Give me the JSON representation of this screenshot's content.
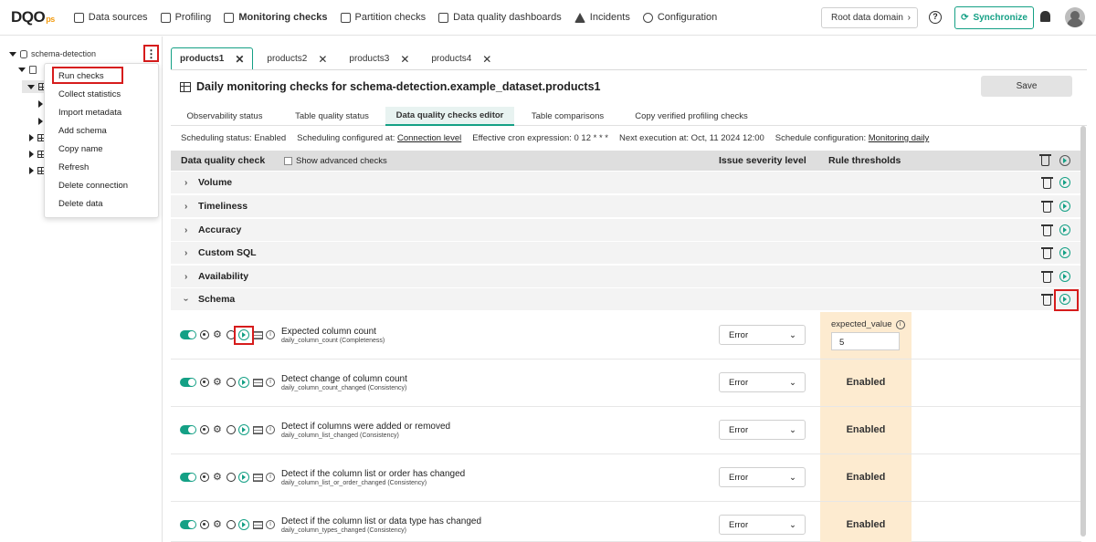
{
  "logo": {
    "main": "DQO",
    "suffix": "ps"
  },
  "nav": [
    {
      "label": "Data sources",
      "icon": "data-sources-icon"
    },
    {
      "label": "Profiling",
      "icon": "profiling-icon"
    },
    {
      "label": "Monitoring checks",
      "icon": "monitoring-icon",
      "active": true
    },
    {
      "label": "Partition checks",
      "icon": "partition-icon"
    },
    {
      "label": "Data quality dashboards",
      "icon": "dashboard-icon"
    },
    {
      "label": "Incidents",
      "icon": "warning-icon"
    },
    {
      "label": "Configuration",
      "icon": "gear-icon"
    }
  ],
  "header": {
    "root_domain": "Root data domain",
    "help": "?",
    "sync": "Synchronize"
  },
  "sidebar": {
    "connection": "schema-detection",
    "menu_dots": "⋮",
    "context_menu": [
      "Run checks",
      "Collect statistics",
      "Import metadata",
      "Add schema",
      "Copy name",
      "Refresh",
      "Delete connection",
      "Delete data"
    ]
  },
  "tabs": [
    {
      "label": "products1",
      "active": true
    },
    {
      "label": "products2"
    },
    {
      "label": "products3"
    },
    {
      "label": "products4"
    }
  ],
  "tab_close": "✕",
  "page_title": "Daily monitoring checks for schema-detection.example_dataset.products1",
  "save_label": "Save",
  "subtabs": [
    "Observability status",
    "Table quality status",
    "Data quality checks editor",
    "Table comparisons",
    "Copy verified profiling checks"
  ],
  "schedule": {
    "status": "Scheduling status: Enabled",
    "configured_prefix": "Scheduling configured at:",
    "configured_link": "Connection level",
    "cron": "Effective cron expression: 0 12 * * *",
    "next": "Next execution at: Oct, 11 2024 12:00",
    "config_prefix": "Schedule configuration:",
    "config_link": "Monitoring daily"
  },
  "table": {
    "col_check": "Data quality check",
    "advanced": "Show advanced checks",
    "col_severity": "Issue severity level",
    "col_thresholds": "Rule thresholds"
  },
  "groups": [
    "Volume",
    "Timeliness",
    "Accuracy",
    "Custom SQL",
    "Availability",
    "Schema"
  ],
  "checks": [
    {
      "name": "Expected column count",
      "sub": "daily_column_count (Completeness)",
      "severity": "Error",
      "threshold_label": "expected_value",
      "threshold_value": "5"
    },
    {
      "name": "Detect change of column count",
      "sub": "daily_column_count_changed (Consistency)",
      "severity": "Error",
      "threshold": "Enabled"
    },
    {
      "name": "Detect if columns were added or removed",
      "sub": "daily_column_list_changed (Consistency)",
      "severity": "Error",
      "threshold": "Enabled"
    },
    {
      "name": "Detect if the column list or order has changed",
      "sub": "daily_column_list_or_order_changed (Consistency)",
      "severity": "Error",
      "threshold": "Enabled"
    },
    {
      "name": "Detect if the column list or data type has changed",
      "sub": "daily_column_types_changed (Consistency)",
      "severity": "Error",
      "threshold": "Enabled"
    }
  ],
  "colors": {
    "accent": "#14a085",
    "highlight": "#d61c1c",
    "threshold_bg": "#fdebd0"
  }
}
